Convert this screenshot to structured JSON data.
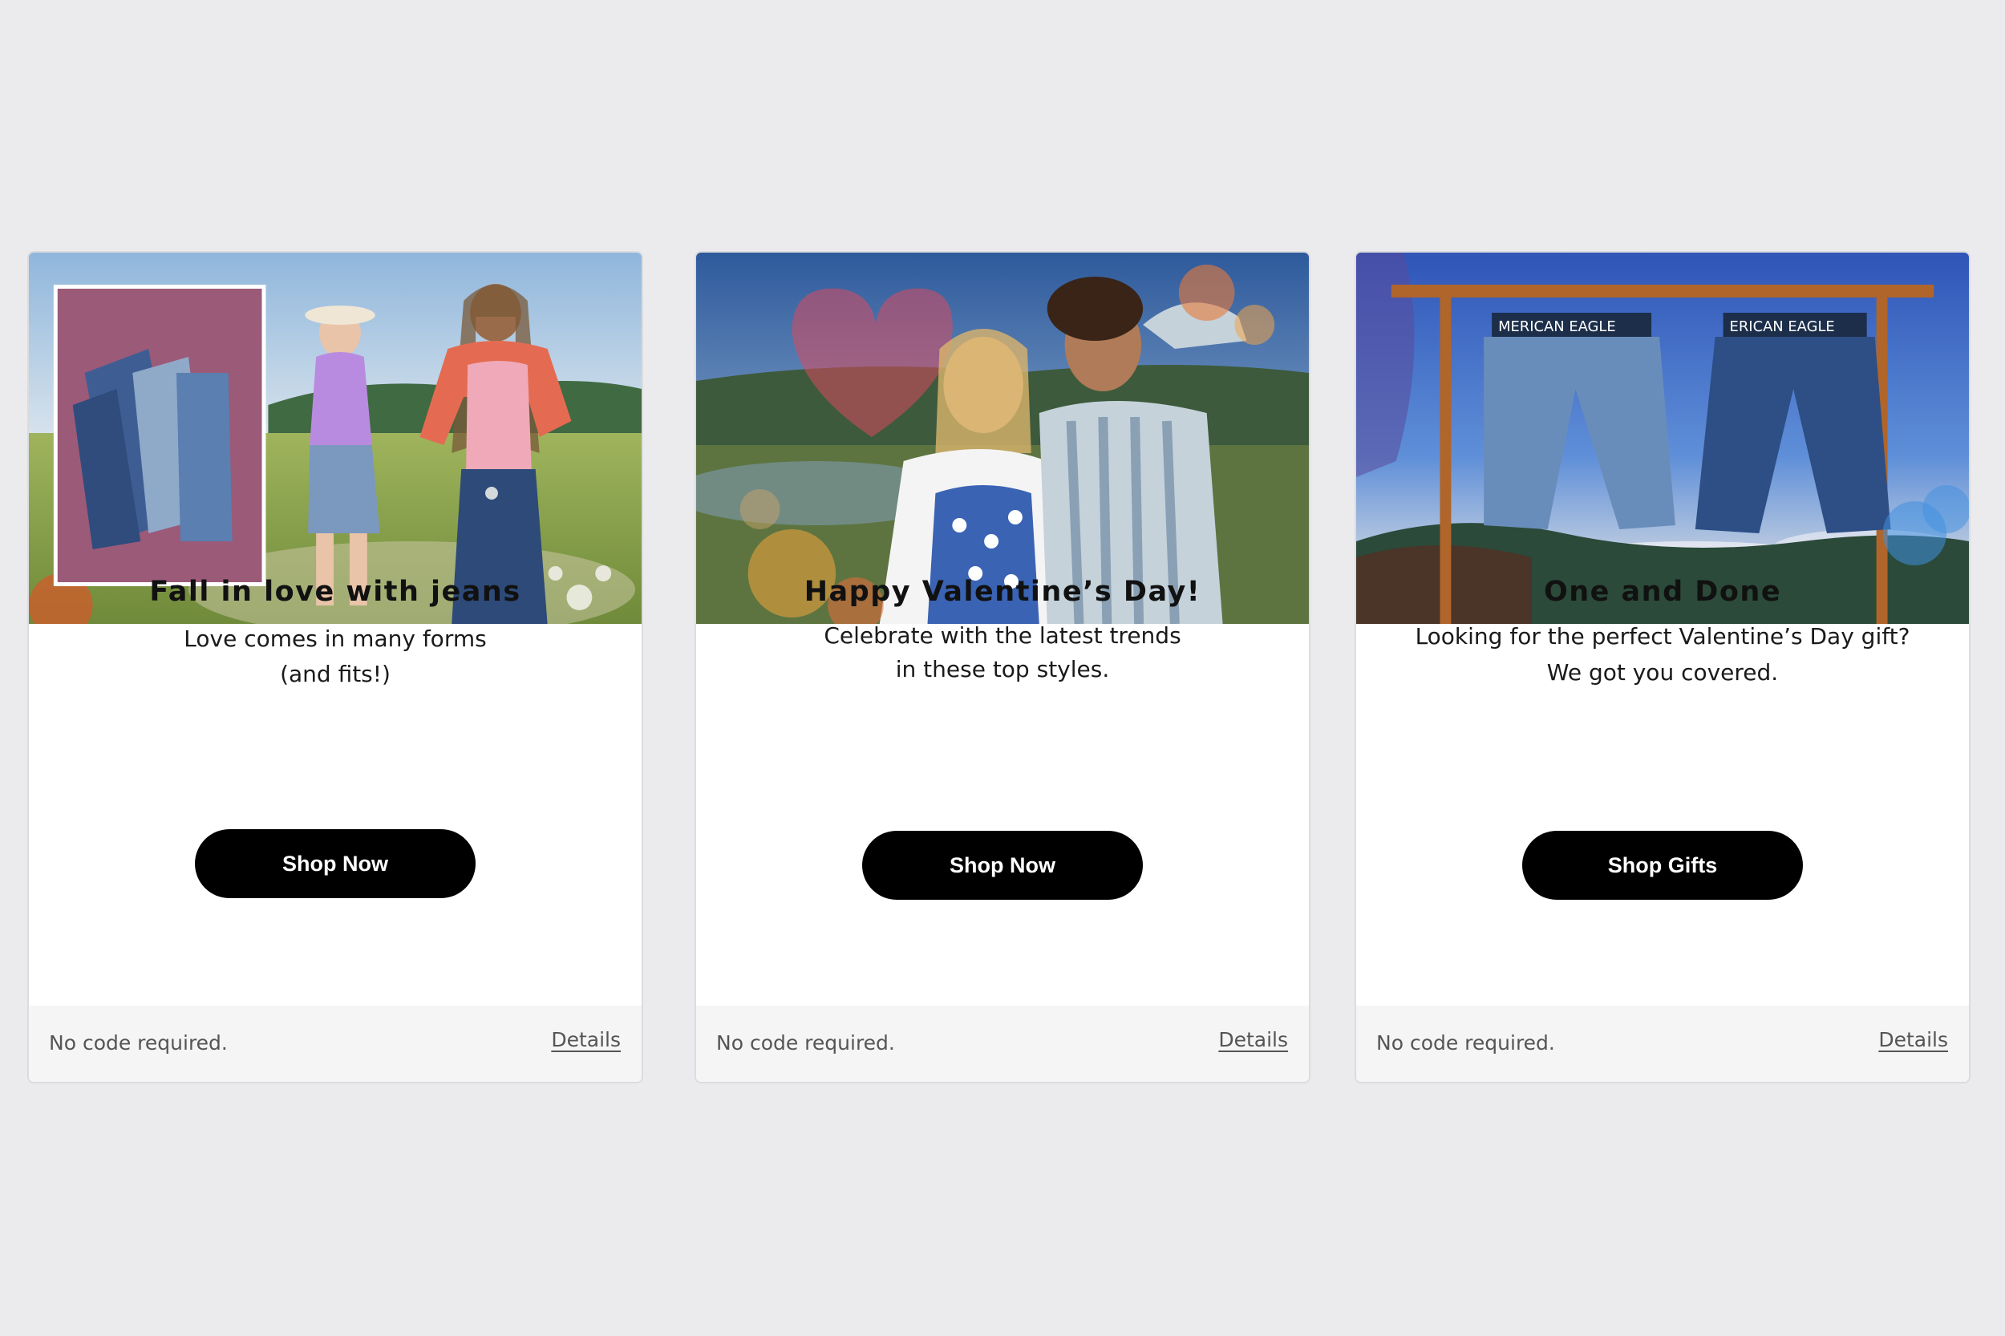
{
  "cards": [
    {
      "image_alt": "Two women walking through a meadow holding hands, inset of jeans on pink flowers",
      "title": "Fall in love with jeans",
      "subtitle_line1": "Love comes in many forms",
      "subtitle_line2": "(and fits!)",
      "button_label": "Shop Now",
      "footer_note": "No code required.",
      "details_label": "Details"
    },
    {
      "image_alt": "Couple smiling in a field of flowers with heart shape in the sky",
      "title": "Happy Valentine’s Day!",
      "subtitle_line1": "Celebrate with the latest trends",
      "subtitle_line2": "in these top styles.",
      "button_label": "Shop Now",
      "footer_note": "No code required.",
      "details_label": "Details"
    },
    {
      "image_alt": "Two pairs of denim shorts hanging from a wooden frame against blue sky",
      "title": "One and Done",
      "subtitle_line1": "Looking for the perfect Valentine’s Day gift?",
      "subtitle_line2": "We got you covered.",
      "button_label": "Shop Gifts",
      "footer_note": "No code required.",
      "details_label": "Details",
      "boxer_print_text": "MERICAN EAGLE",
      "boxer_print_text_2": "ERICAN EAGLE"
    }
  ],
  "colors": {
    "page_background": "#ebebed",
    "card_background": "#ffffff",
    "footer_background": "#f5f5f5",
    "button_background": "#000000",
    "button_text": "#ffffff"
  }
}
